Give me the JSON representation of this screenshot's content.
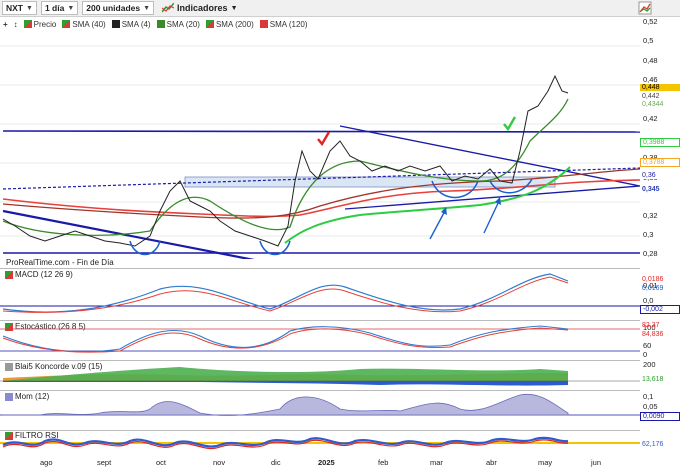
{
  "toolbar": {
    "ticker": "NXT",
    "interval": "1 día",
    "units": "200 unidades",
    "indicators_label": "Indicadores"
  },
  "legend": {
    "items": [
      "Precio",
      "SMA (40)",
      "SMA (4)",
      "SMA (20)",
      "SMA (200)",
      "SMA (120)"
    ]
  },
  "main_chart": {
    "source": "ProRealTime.com - Fin de Día",
    "y_ticks": [
      "0,52",
      "0,5",
      "0,48",
      "0,46",
      "0,42",
      "0,38",
      "0,36",
      "0,32",
      "0,3",
      "0,28"
    ],
    "tags": [
      "0,448",
      "0,442",
      "0,4344",
      "0,3988",
      "0,3788",
      "0,36",
      "0,345"
    ],
    "tag_colors": [
      "#f5c400",
      "#444444",
      "#6aa84f",
      "#2ecc40",
      "#f5a623",
      "#1a1a9a",
      "#2b3fb0"
    ]
  },
  "panels": {
    "macd": {
      "label": "MACD (12 26 9)",
      "ticks": [
        "0,01",
        "0,0",
        "0,02"
      ],
      "tags": [
        "0,0186",
        "0,0169",
        "-0,002"
      ]
    },
    "stoch": {
      "label": "Estocástico (26 8 5)",
      "ticks": [
        "100",
        "60",
        "0"
      ],
      "tags": [
        "82,37",
        "84,836"
      ]
    },
    "blai5": {
      "label": "Blai5 Koncorde v.09 (15)",
      "ticks": [
        "200"
      ],
      "tags": [
        "13,618"
      ]
    },
    "mom": {
      "label": "Mom (12)",
      "ticks": [
        "0,1",
        "0,05"
      ],
      "tags": [
        "0,0090"
      ]
    },
    "rsi": {
      "label": "FILTRO RSI",
      "tags": [
        "62,176"
      ]
    }
  },
  "x_axis": [
    "ago",
    "sept",
    "oct",
    "nov",
    "dic",
    "2025",
    "feb",
    "mar",
    "abr",
    "may",
    "jun"
  ],
  "colors": {
    "price_line": "#1a1a9a",
    "sma40": "#2ecc40",
    "sma4": "#222222",
    "sma20": "#3a8a2a",
    "sma200": "#e8403a",
    "sma120": "#c04030",
    "toolbar_bg": "#f0f0f0"
  }
}
